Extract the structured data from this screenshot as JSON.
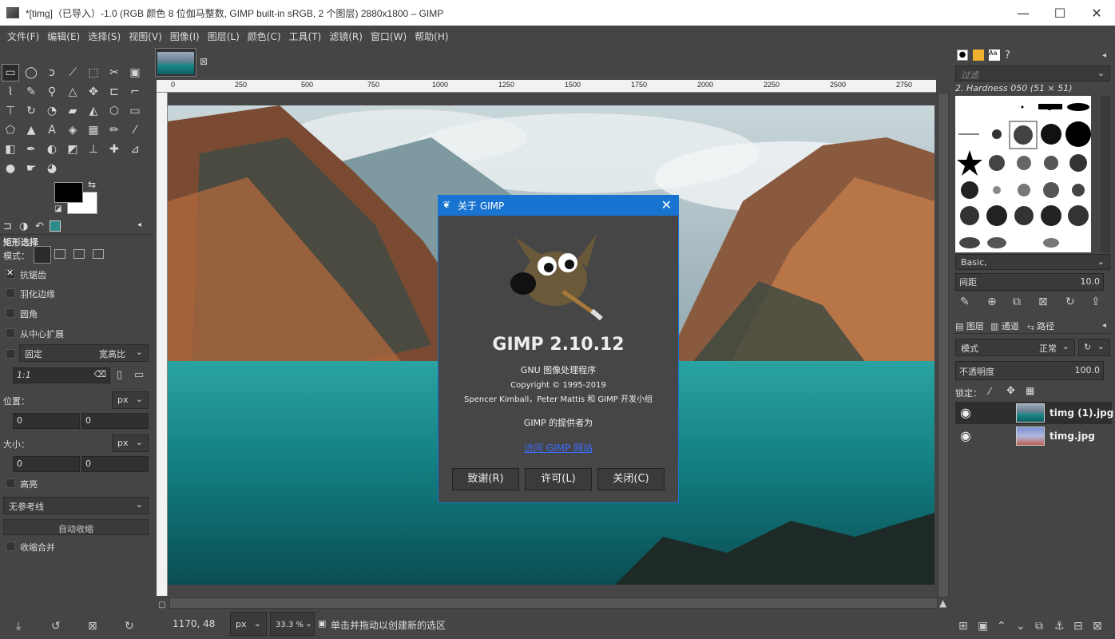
{
  "window": {
    "title": "*[timg]（已导入）-1.0 (RGB 颜色 8 位伽马整数, GIMP built-in sRGB, 2 个图层) 2880x1800 – GIMP",
    "minimize": "—",
    "maximize": "☐",
    "close": "✕"
  },
  "menu": [
    "文件(F)",
    "编辑(E)",
    "选择(S)",
    "视图(V)",
    "图像(I)",
    "图层(L)",
    "颜色(C)",
    "工具(T)",
    "滤镜(R)",
    "窗口(W)",
    "帮助(H)"
  ],
  "tool_options": {
    "title": "矩形选择",
    "mode_label": "模式：",
    "antialias": "抗锯齿",
    "feather": "羽化边缘",
    "rounded": "圆角",
    "expand_center": "从中心扩展",
    "fixed": "固定",
    "fixed_value": "宽高比",
    "ratio": "1:1",
    "position_label": "位置：",
    "position_unit": "px",
    "pos_x": "0",
    "pos_y": "0",
    "size_label": "大小：",
    "size_unit": "px",
    "size_w": "0",
    "size_h": "0",
    "highlight": "高亮",
    "guides": "无参考线",
    "autoshrink": "自动收缩",
    "shrink_merged": "收缩合并"
  },
  "ruler": {
    "marks": [
      "0",
      "250",
      "500",
      "750",
      "1000",
      "1250",
      "1500",
      "1750",
      "2000",
      "2250",
      "2500",
      "2750"
    ]
  },
  "status": {
    "coords": "1170, 48",
    "unit": "px",
    "zoom": "33.3 %",
    "message": "单击并拖动以创建新的选区"
  },
  "dialog": {
    "title": "关于 GIMP",
    "version": "GIMP 2.10.12",
    "subtitle": "GNU 图像处理程序",
    "copyright": "Copyright © 1995-2019",
    "authors": "Spencer Kimball，Peter Mattis 和 GIMP 开发小组",
    "provided_by": "GIMP 的提供者为",
    "link": "访问 GIMP 网站",
    "buttons": [
      "致谢(R)",
      "许可(L)",
      "关闭(C)"
    ]
  },
  "brushes": {
    "filter_placeholder": "过滤",
    "selected": "2. Hardness 050 (51 × 51)",
    "preset": "Basic,",
    "spacing_label": "间距",
    "spacing_value": "10.0"
  },
  "layers_panel": {
    "tabs": [
      "图层",
      "通道",
      "路径"
    ],
    "mode_label": "模式",
    "mode_value": "正常",
    "opacity_label": "不透明度",
    "opacity_value": "100.0",
    "lock_label": "锁定：",
    "layers": [
      {
        "name": "timg (1).jpg"
      },
      {
        "name": "timg.jpg"
      }
    ]
  },
  "colors": {
    "accent": "#1874d0",
    "panel": "#454545",
    "water": "#0d6b6d"
  }
}
